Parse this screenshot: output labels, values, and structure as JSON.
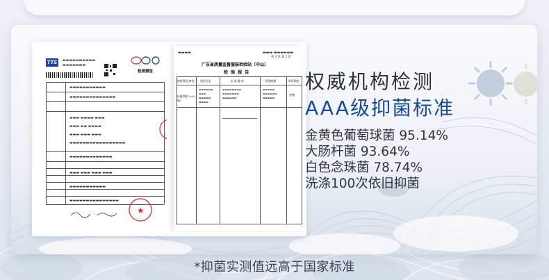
{
  "heading": {
    "line1": "权威机构检测",
    "line2": "AAA级抑菌标准"
  },
  "rates": [
    "金黄色葡萄球菌 95.14%",
    "大肠杆菌 93.64%",
    "白色念珠菌 78.74%",
    "洗涤100次依旧抑菌"
  ],
  "caption": "*抑菌实测值远高于国家标准",
  "report": {
    "logo": "TTS",
    "title": "检测报告",
    "right_title": "广东省质量监督服装检验站（中山）",
    "right_subtitle": "检 验 报 告",
    "right_pageno": "共 3 页  第 2 页",
    "right_headers": [
      "检验项目(单位)",
      "测试方法",
      "标 准 要 求",
      "检测结果",
      "单项判定"
    ],
    "right_row_label": "抗菌性能 (AAA级)",
    "right_result": "合格"
  },
  "colors": {
    "accent": "#1a4a93",
    "text": "#2a3141",
    "background": "#e9eef4"
  }
}
